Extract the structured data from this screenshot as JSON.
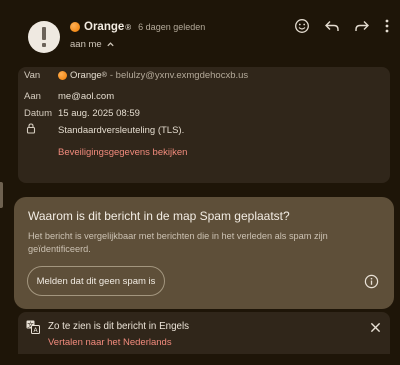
{
  "header": {
    "sender_name": "Orange",
    "sender_reg": "®",
    "sent_time": "6 dagen geleden",
    "recipient_summary": "aan me"
  },
  "details": {
    "from_label": "Van",
    "from_name": "Orange",
    "from_reg": "®",
    "from_address": "- belulzy@yxnv.exmgdehocxb.us",
    "to_label": "Aan",
    "to_value": "me@aol.com",
    "date_label": "Datum",
    "date_value": "15 aug. 2025 08:59",
    "encryption_value": "Standaardversleuteling (TLS).",
    "security_link": "Beveiligingsgegevens bekijken"
  },
  "spam_notice": {
    "title": "Waarom is dit bericht in de map Spam geplaatst?",
    "description": "Het bericht is vergelijkbaar met berichten die in het verleden als spam zijn geïdentificeerd.",
    "not_spam_button": "Melden dat dit geen spam is"
  },
  "translate_bar": {
    "title": "Zo te zien is dit bericht in Engels",
    "translate_link": "Vertalen naar het Nederlands"
  },
  "icons": [
    "alert-icon",
    "chevron-up-icon",
    "emoji-icon",
    "reply-icon",
    "forward-icon",
    "more-vert-icon",
    "lock-icon",
    "info-icon",
    "translate-icon",
    "close-icon"
  ],
  "colors": {
    "background": "#1e1508",
    "card": "#30261a",
    "spam_card": "#5e4f39",
    "link": "#f28b7d",
    "brand_orange": "#f07c00"
  }
}
